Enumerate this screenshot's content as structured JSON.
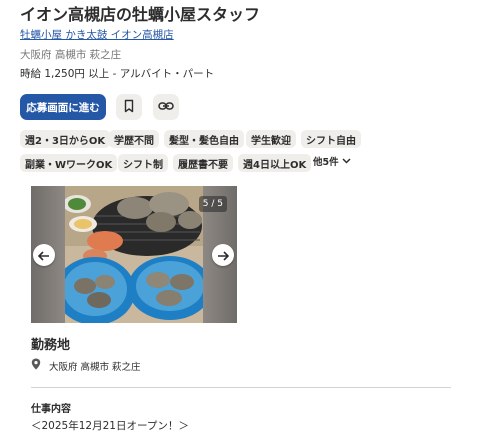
{
  "job": {
    "title": "イオン高槻店の牡蠣小屋スタッフ",
    "company": "牡蠣小屋 かき太鼓 イオン高槻店",
    "location": "大阪府 高槻市 萩之庄",
    "salary": "時給 1,250円 以上 - アルバイト・パート"
  },
  "actions": {
    "apply_label": "応募画面に進む",
    "save_icon": "bookmark-icon",
    "share_icon": "link-icon"
  },
  "tags": [
    "週2・3日からOK",
    "学歴不問",
    "髪型・髪色自由",
    "学生歓迎",
    "シフト自由",
    "副業・WワークOK",
    "シフト制",
    "履歴書不要",
    "週4日以上OK"
  ],
  "more_label": "他5件",
  "carousel": {
    "counter": "5 / 5",
    "prev_icon": "arrow-left-icon",
    "next_icon": "arrow-right-icon"
  },
  "workplace": {
    "heading": "勤務地",
    "address": "大阪府 高槻市 萩之庄"
  },
  "description": {
    "heading": "仕事内容",
    "first_line": "＜2025年12月21日オープン！＞"
  },
  "colors": {
    "accent": "#2557a7",
    "tag_bg": "#efeeea",
    "text": "#2d2d2d",
    "muted": "#767676"
  }
}
